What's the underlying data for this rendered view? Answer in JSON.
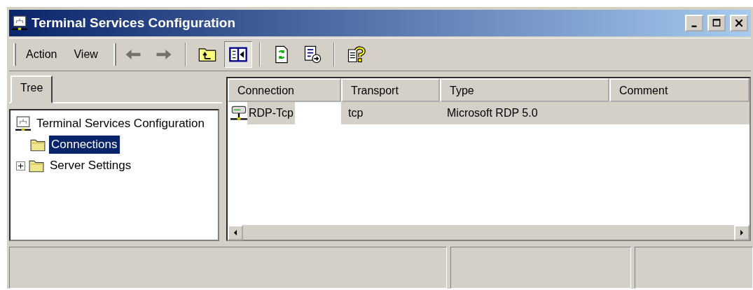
{
  "window": {
    "title": "Terminal Services Configuration"
  },
  "menu": [
    {
      "label": "Action"
    },
    {
      "label": "View"
    }
  ],
  "toolbar": [
    {
      "kind": "back",
      "disabled": true,
      "pressed": false
    },
    {
      "kind": "forward",
      "disabled": true,
      "pressed": false
    },
    {
      "kind": "up",
      "disabled": false,
      "pressed": false
    },
    {
      "kind": "tree",
      "disabled": false,
      "pressed": true
    },
    {
      "kind": "refresh",
      "disabled": false,
      "pressed": false
    },
    {
      "kind": "export",
      "disabled": false,
      "pressed": false
    },
    {
      "kind": "help",
      "disabled": false,
      "pressed": false
    }
  ],
  "tabs": [
    {
      "label": "Tree",
      "selected": true
    }
  ],
  "tree": [
    {
      "label": "Terminal Services Configuration",
      "kind": "computer",
      "selected": false,
      "children": [
        {
          "label": "Connections",
          "kind": "folder",
          "selected": true
        },
        {
          "label": "Server Settings",
          "kind": "folder",
          "selected": false,
          "expanded": false
        }
      ]
    }
  ],
  "table": {
    "columns": [
      "Connection",
      "Transport",
      "Type",
      "Comment"
    ],
    "rows": [
      {
        "connection": "RDP-Tcp",
        "transport": "tcp",
        "type": "Microsoft RDP 5.0",
        "selected": true
      }
    ]
  }
}
